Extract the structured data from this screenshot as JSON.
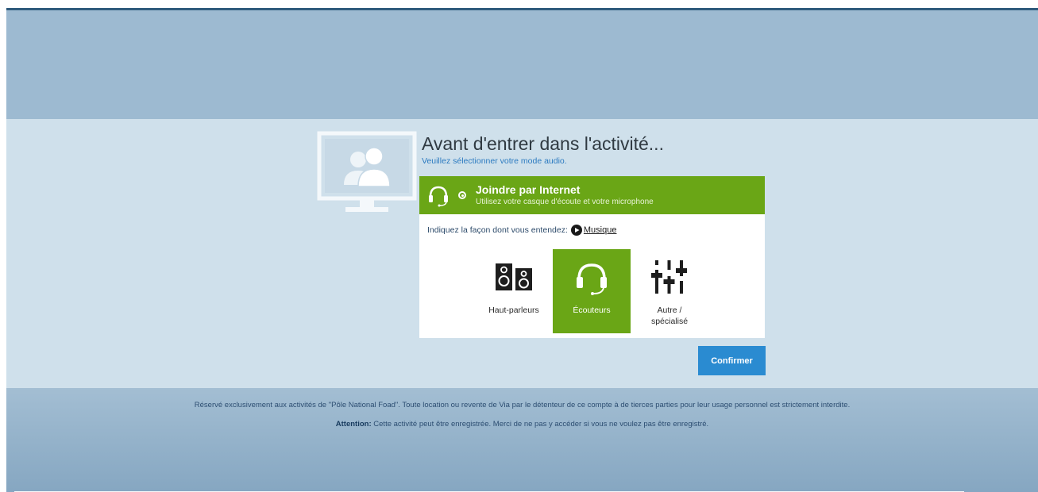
{
  "header": {
    "title": "Avant d'entrer dans l'activité...",
    "subtitle": "Veuillez sélectionner votre mode audio."
  },
  "audio_option": {
    "title": "Joindre par Internet",
    "subtitle": "Utilisez votre casque d'écoute et votre microphone",
    "selected": true
  },
  "hearing": {
    "prompt": "Indiquez la façon dont vous entendez:",
    "music_link": "Musique"
  },
  "devices": [
    {
      "label": "Haut-parleurs",
      "icon": "speakers-icon",
      "selected": false
    },
    {
      "label": "Écouteurs",
      "icon": "headphones-icon",
      "selected": true
    },
    {
      "label_line1": "Autre /",
      "label_line2": "spécialisé",
      "icon": "equalizer-icon",
      "selected": false
    }
  ],
  "confirm_label": "Confirmer",
  "footer": {
    "legal": "Réservé exclusivement aux activités de \"Pôle National Foad\". Toute location ou revente de Via par le détenteur de ce compte à de tierces parties pour leur usage personnel est strictement interdite.",
    "attention_label": "Attention:",
    "attention_text": "Cette activité peut être enregistrée. Merci de ne pas y accéder si vous ne voulez pas être enregistré."
  },
  "colors": {
    "accent_green": "#6aa616",
    "confirm_blue": "#2a8bd1",
    "background": "#cfe0eb"
  }
}
